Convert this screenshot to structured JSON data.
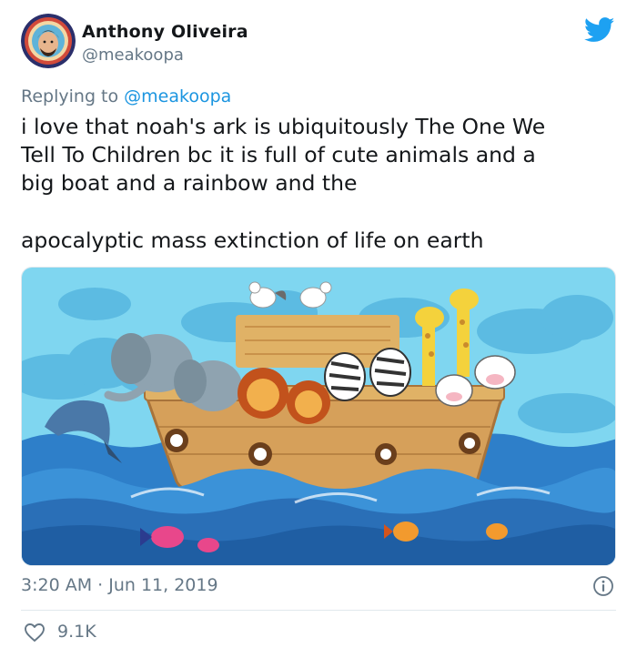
{
  "author": {
    "name": "Anthony Oliveira",
    "handle": "@meakoopa"
  },
  "reply": {
    "prefix": "Replying to ",
    "mention": "@meakoopa"
  },
  "tweet": {
    "lines": [
      "i love that noah's ark is ubiquitously The One We",
      "Tell To Children bc it is full of cute animals and a",
      "big boat and a rainbow and the",
      "apocalyptic mass extinction of life on earth"
    ]
  },
  "meta": {
    "timestamp": "3:20 AM · Jun 11, 2019",
    "likes": "9.1K"
  },
  "colors": {
    "brand": "#1da1f2",
    "mention": "#1b95e0",
    "muted": "#657786"
  },
  "icons": {
    "brand": "twitter-bird-icon",
    "info": "info-icon",
    "like": "heart-icon"
  }
}
